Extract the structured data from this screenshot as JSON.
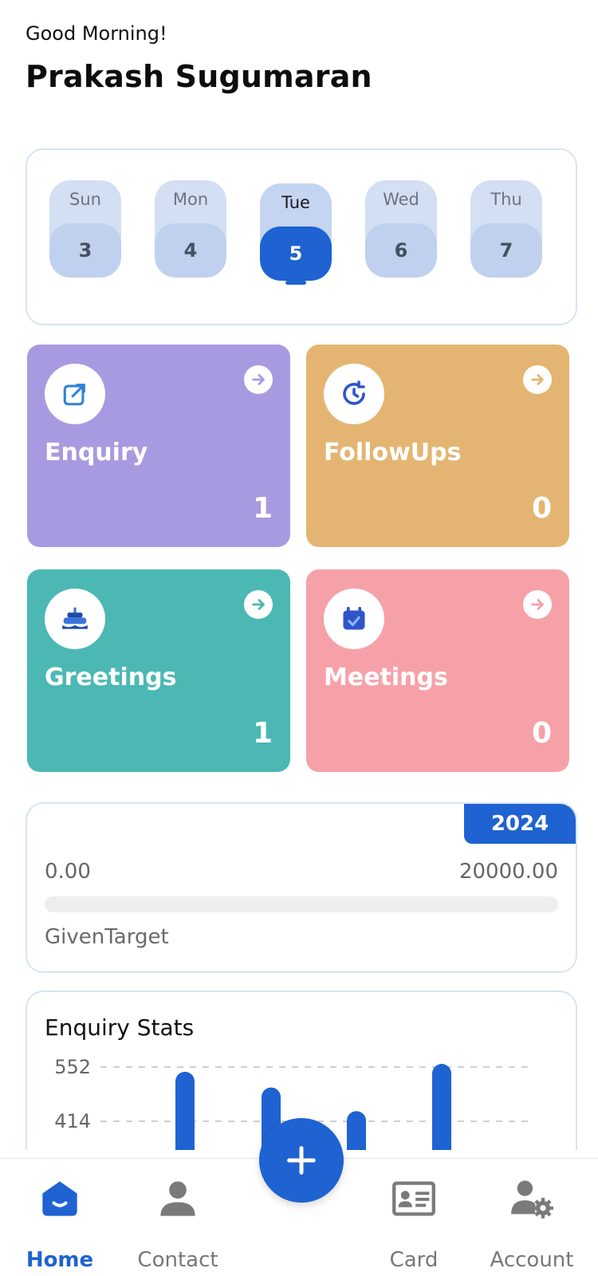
{
  "header": {
    "greeting": "Good Morning!",
    "username": "Prakash Sugumaran"
  },
  "calendar": {
    "days": [
      {
        "name": "Sun",
        "num": "3"
      },
      {
        "name": "Mon",
        "num": "4"
      },
      {
        "name": "Tue",
        "num": "5"
      },
      {
        "name": "Wed",
        "num": "6"
      },
      {
        "name": "Thu",
        "num": "7"
      }
    ],
    "selected": "Tue"
  },
  "tiles": {
    "enquiry": {
      "label": "Enquiry",
      "count": "1",
      "color": "#a89ae0",
      "icon": "external-link-icon"
    },
    "followups": {
      "label": "FollowUps",
      "count": "0",
      "color": "#e4b572",
      "icon": "clock-refresh-icon"
    },
    "greetings": {
      "label": "Greetings",
      "count": "1",
      "color": "#4bb8b4",
      "icon": "cake-icon"
    },
    "meetings": {
      "label": "Meetings",
      "count": "0",
      "color": "#f6a1a8",
      "icon": "calendar-check-icon"
    }
  },
  "target": {
    "year": "2024",
    "min": "0.00",
    "max": "20000.00",
    "label": "GivenTarget",
    "progress": 0
  },
  "stats": {
    "title": "Enquiry Stats"
  },
  "chart_data": {
    "type": "bar",
    "title": "Enquiry Stats",
    "y_ticks": [
      "552",
      "414"
    ],
    "values_note": "partially visible",
    "values": [
      540,
      500,
      440,
      560
    ],
    "grid": true
  },
  "nav": {
    "home": "Home",
    "contact": "Contact",
    "card": "Card",
    "account": "Account"
  },
  "colors": {
    "primary": "#1f62d1"
  }
}
